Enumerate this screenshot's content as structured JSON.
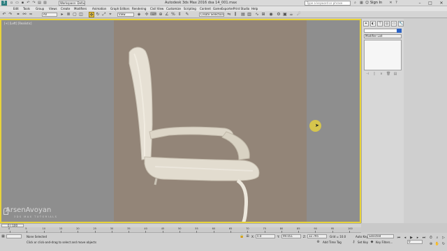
{
  "titlebar": {
    "workspace": "Workspace: Default",
    "app_title": "Autodesk 3ds Max 2016    dsa 14_001.max",
    "search_placeholder": "Type a keyword or phrase",
    "signin": "Sign In",
    "minimize": "–",
    "maximize": "□",
    "close": "✕"
  },
  "menu": [
    "Edit",
    "Tools",
    "Group",
    "Views",
    "Create",
    "Modifiers",
    "Animation",
    "Graph Editors",
    "Rendering",
    "Civil View",
    "Customize",
    "Scripting",
    "Content",
    "GameExporter",
    "Print Studio",
    "Help"
  ],
  "toolbar": {
    "filter_select": "All",
    "view_select": "View",
    "selection_set": "Create Selection Se"
  },
  "viewport": {
    "label": "[+] [Left] [Realistic]",
    "accent_color": "#e8d33a"
  },
  "watermark": {
    "name": "ArsenAvoyan",
    "subtitle": "3DS MAX TUTORIALS"
  },
  "command_panel": {
    "modifier_list": "Modifier List",
    "object_color": "#2b63c6"
  },
  "timeline": {
    "frame_display": "0 / 100",
    "ticks": [
      "0",
      "5",
      "10",
      "15",
      "20",
      "25",
      "30",
      "35",
      "40",
      "45",
      "50",
      "55",
      "60",
      "65",
      "70",
      "75",
      "80",
      "85",
      "90",
      "95",
      "100"
    ]
  },
  "status": {
    "selection": "None Selected",
    "prompt": "Click or click-and-drag to select and move objects",
    "x_label": "X:",
    "x_value": "0.0",
    "y_label": "Y:",
    "y_value": "99.051",
    "z_label": "Z:",
    "z_value": "32.795",
    "grid": "Grid = 10.0",
    "add_time_tag": "Add Time Tag",
    "auto_key": "Auto Key",
    "set_key": "Set Key",
    "selected": "Selected",
    "key_filters": "Key Filters...",
    "frame": "0"
  }
}
